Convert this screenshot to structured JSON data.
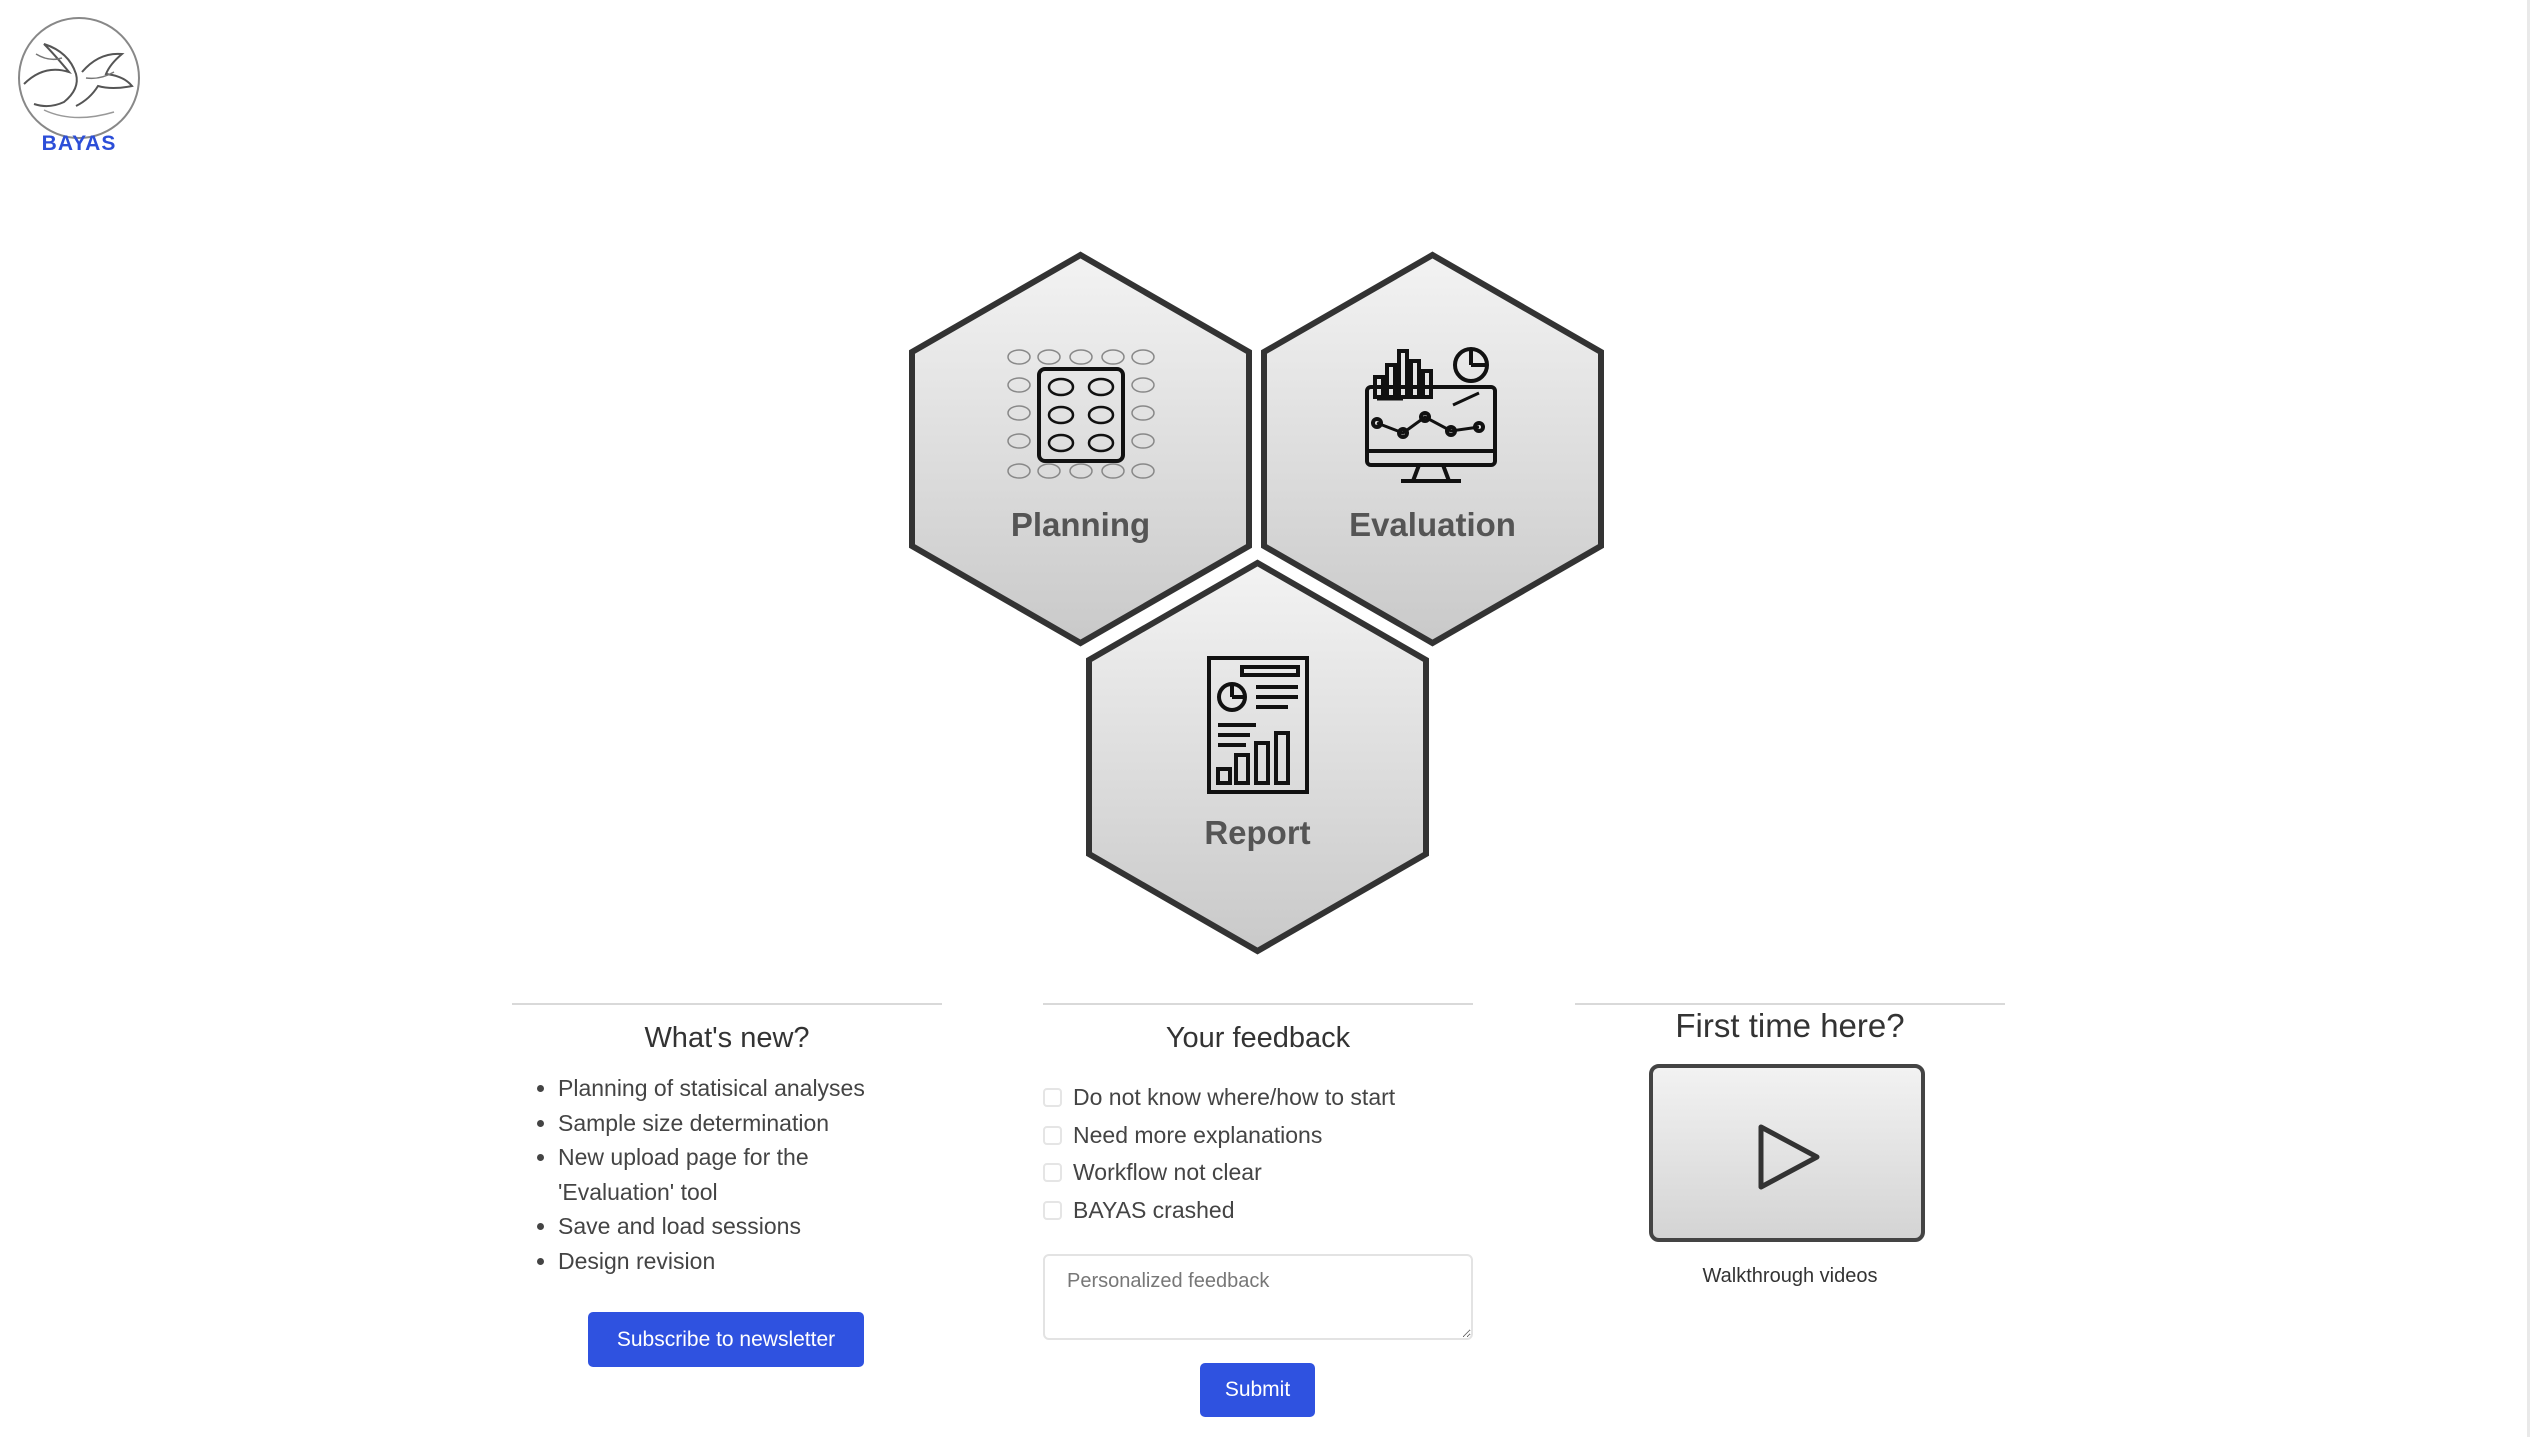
{
  "brand": {
    "logo_text": "BAYAS"
  },
  "tools": [
    {
      "label": "Planning",
      "icon": "animal-grid-icon"
    },
    {
      "label": "Evaluation",
      "icon": "monitor-chart-icon"
    },
    {
      "label": "Report",
      "icon": "report-document-icon"
    }
  ],
  "whats_new": {
    "title": "What's new?",
    "items": [
      "Planning of statisical analyses",
      "Sample size determination",
      "New upload page for the 'Evaluation' tool",
      "Save and load sessions",
      "Design revision"
    ],
    "subscribe_label": "Subscribe to newsletter"
  },
  "feedback": {
    "title": "Your feedback",
    "options": [
      "Do not know where/how to start",
      "Need more explanations",
      "Workflow not clear",
      "BAYAS crashed"
    ],
    "placeholder": "Personalized feedback",
    "submit_label": "Submit"
  },
  "first_time": {
    "title": "First time here?",
    "video_icon": "play-icon",
    "caption": "Walkthrough videos"
  },
  "colors": {
    "accent": "#2f52e0",
    "brand_text": "#2c4ed8",
    "hex_border": "#333333"
  }
}
